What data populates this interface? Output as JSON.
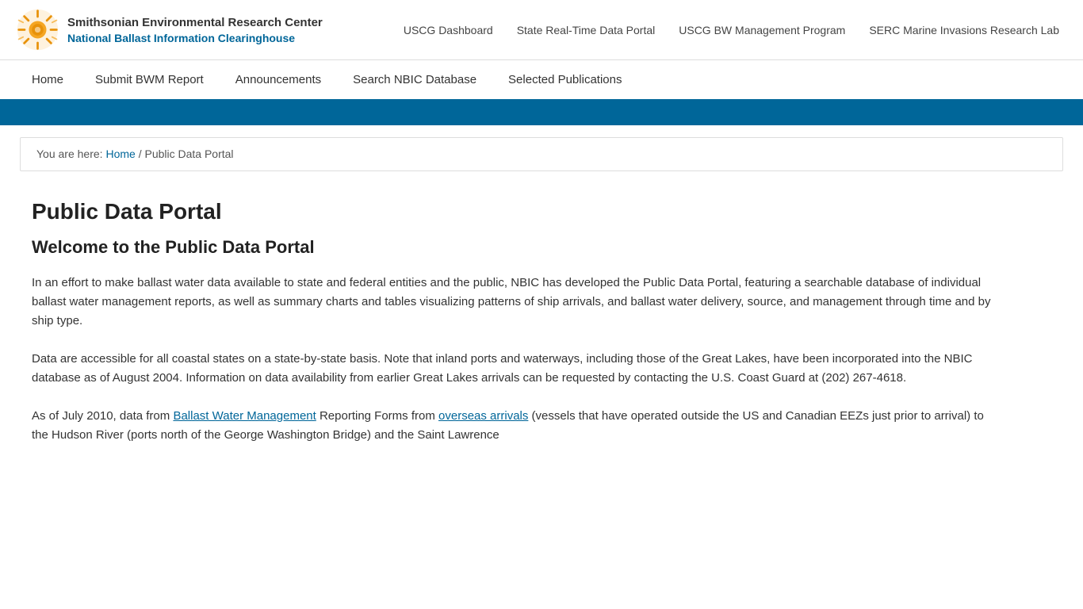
{
  "header": {
    "org_name": "Smithsonian Environmental Research Center",
    "org_subtitle": "National Ballast Information Clearinghouse",
    "top_nav": [
      {
        "label": "USCG Dashboard",
        "href": "#"
      },
      {
        "label": "State Real-Time Data Portal",
        "href": "#"
      },
      {
        "label": "USCG BW Management Program",
        "href": "#"
      },
      {
        "label": "SERC Marine Invasions Research Lab",
        "href": "#"
      }
    ]
  },
  "main_nav": [
    {
      "label": "Home",
      "href": "#"
    },
    {
      "label": "Submit BWM Report",
      "href": "#"
    },
    {
      "label": "Announcements",
      "href": "#"
    },
    {
      "label": "Search NBIC Database",
      "href": "#"
    },
    {
      "label": "Selected Publications",
      "href": "#"
    }
  ],
  "breadcrumb": {
    "prefix": "You are here: ",
    "home_label": "Home",
    "separator": " / ",
    "current": "Public Data Portal"
  },
  "content": {
    "page_title": "Public Data Portal",
    "page_subtitle": "Welcome to the Public Data Portal",
    "paragraph1": "In an effort to make ballast water data available to state and federal entities and the public, NBIC has developed the Public Data Portal, featuring a searchable database of individual ballast water management reports, as well as summary charts and tables visualizing patterns of ship arrivals, and ballast water delivery, source, and management through time and by ship type.",
    "paragraph2": "Data are accessible for all coastal states on a state-by-state basis. Note that inland ports and waterways, including those of the Great Lakes, have been incorporated into the NBIC database as of August 2004. Information on data availability from earlier Great Lakes arrivals can be requested by contacting the U.S. Coast Guard at (202) 267-4618.",
    "paragraph3_prefix": "As of July 2010, data from ",
    "paragraph3_link1": "Ballast Water Management",
    "paragraph3_middle": " Reporting Forms from ",
    "paragraph3_link2": "overseas arrivals",
    "paragraph3_suffix": " (vessels that have operated outside the US and Canadian EEZs just prior to arrival) to the Hudson River (ports north of the George Washington Bridge) and the Saint Lawrence"
  }
}
